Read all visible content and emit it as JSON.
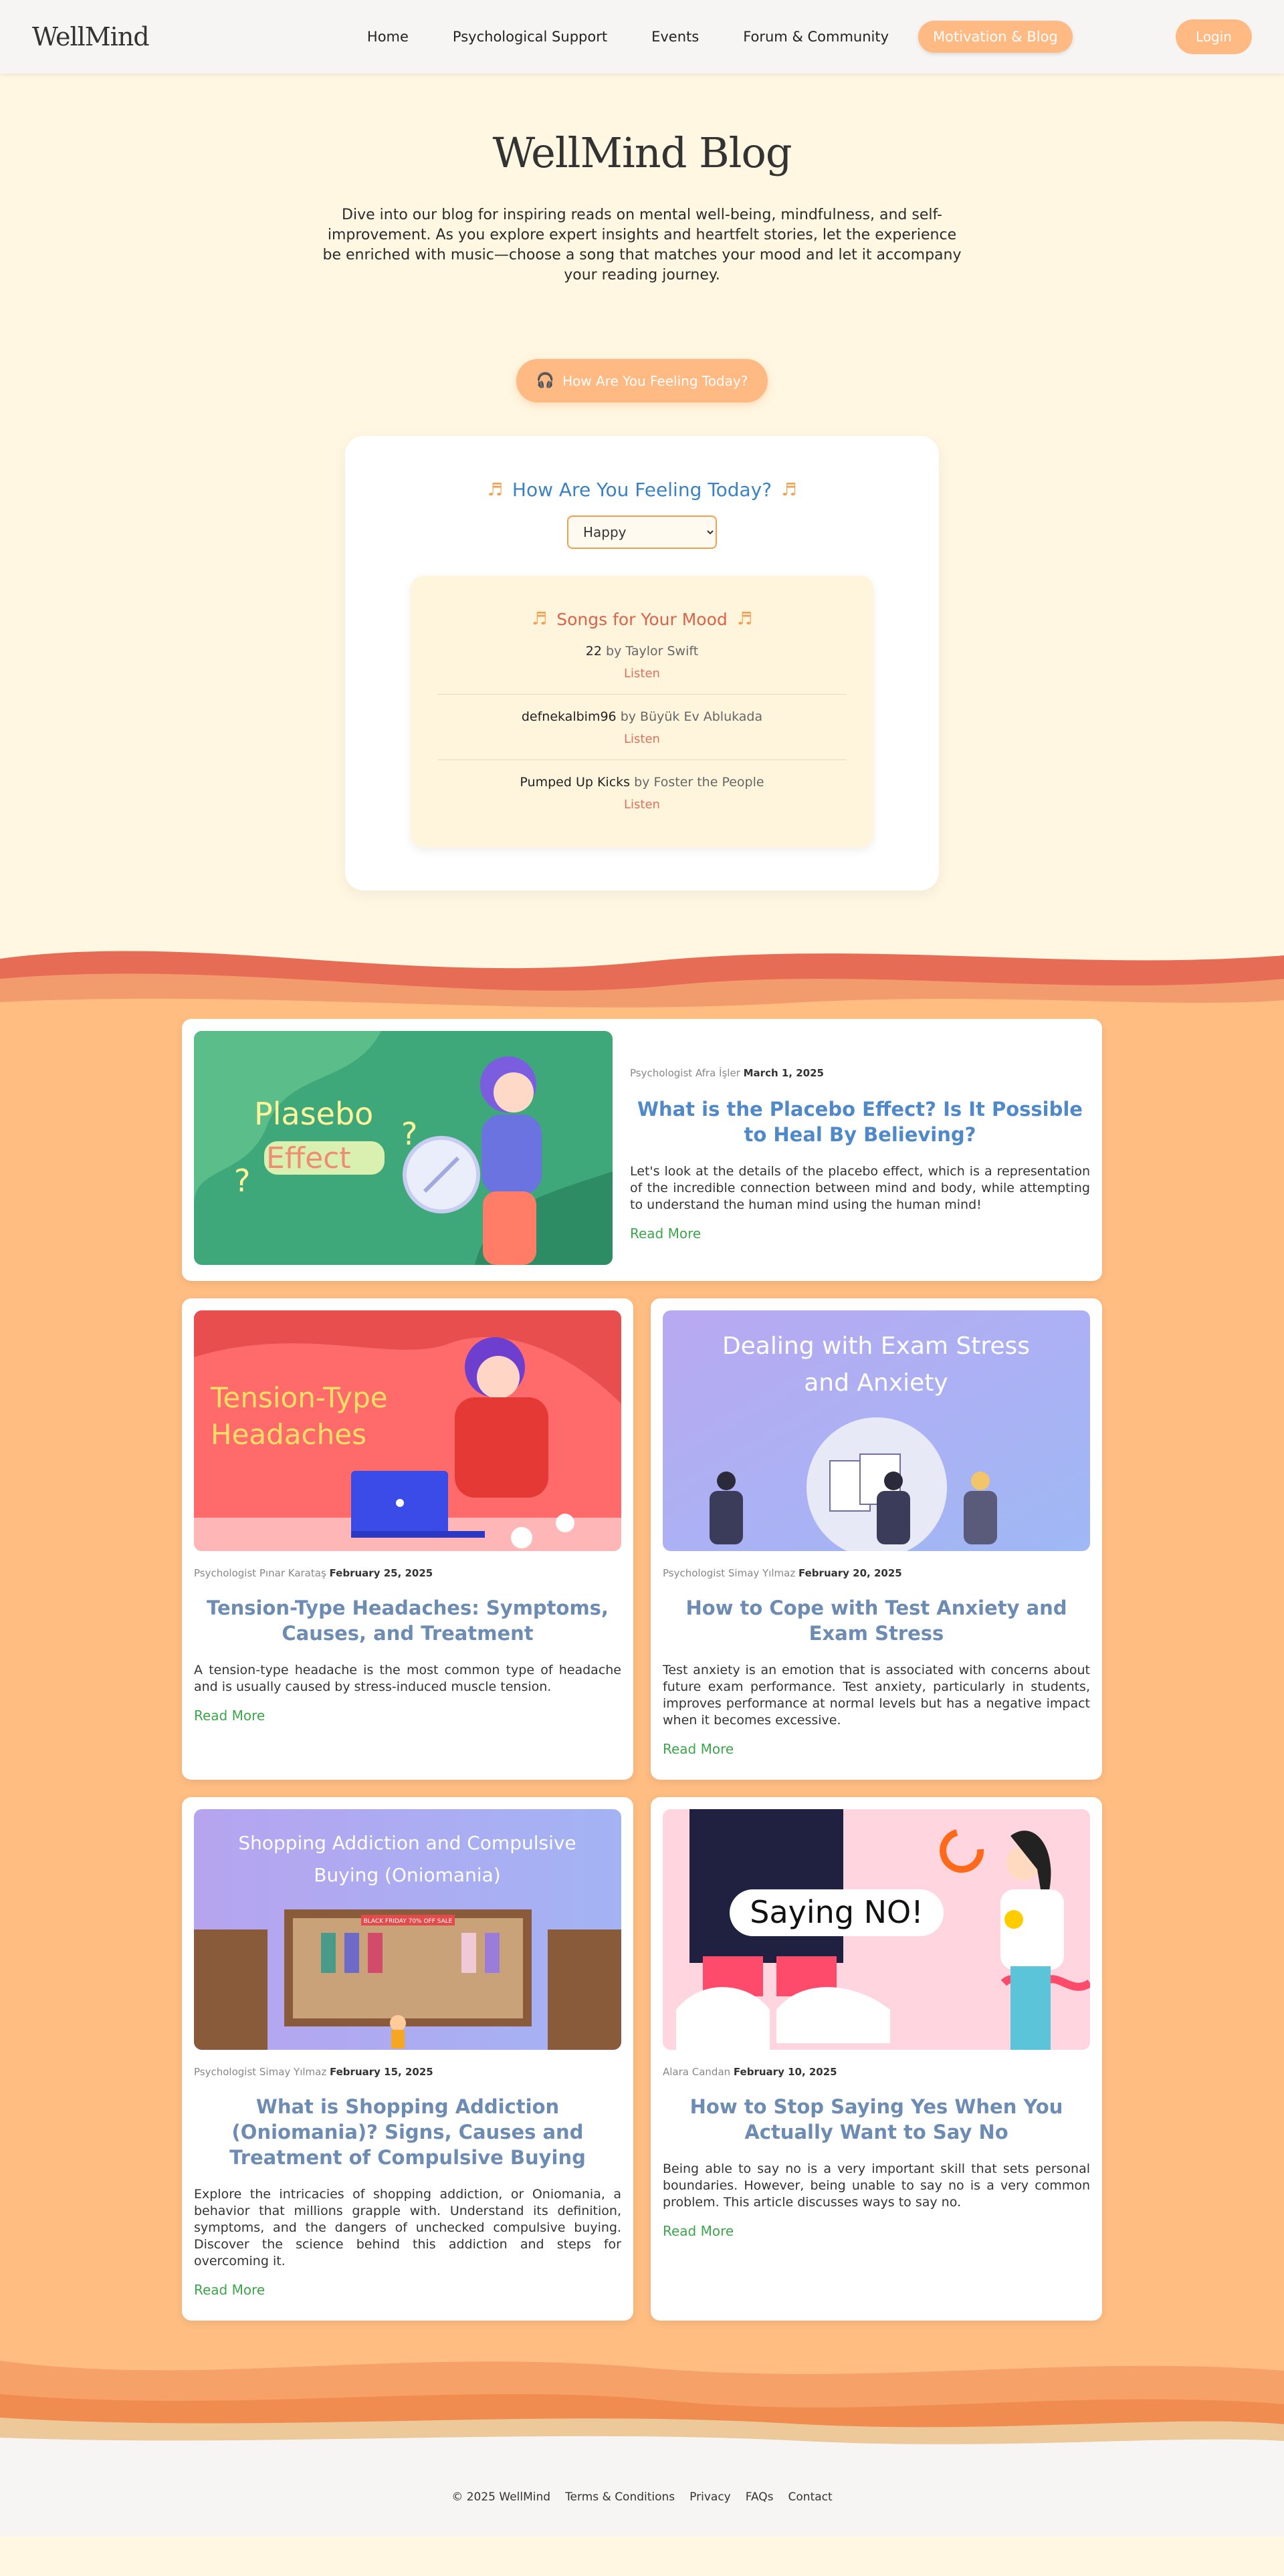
{
  "nav": {
    "logo": "WellMind",
    "links": [
      "Home",
      "Psychological Support",
      "Events",
      "Forum & Community",
      "Motivation & Blog"
    ],
    "login": "Login"
  },
  "hero": {
    "title": "WellMind Blog",
    "intro": "Dive into our blog for inspiring reads on mental well-being, mindfulness, and self-improvement. As you explore expert insights and heartfelt stories, let the experience be enriched with music—choose a song that matches your mood and let it accompany your reading journey.",
    "feeling_button": "How Are You Feeling Today?"
  },
  "mood": {
    "title": "How Are You Feeling Today?",
    "selected": "Happy",
    "songs_title": "Songs for Your Mood",
    "listen_label": "Listen",
    "songs": [
      {
        "title": "22",
        "by": "by",
        "artist": "Taylor Swift"
      },
      {
        "title": "defnekalbim96",
        "by": "by",
        "artist": "Büyük Ev Ablukada"
      },
      {
        "title": "Pumped Up Kicks",
        "by": "by",
        "artist": "Foster the People"
      }
    ]
  },
  "posts": [
    {
      "author": "Psychologist Afra İşler",
      "date": "March 1, 2025",
      "title": "What is the Placebo Effect? Is It Possible to Heal By Believing?",
      "excerpt": "Let's look at the details of the placebo effect, which is a representation of the incredible connection between mind and body, while attempting to understand the human mind using the human mind!",
      "read_more": "Read More",
      "image_text": [
        "Plasebo",
        "Effect"
      ]
    },
    {
      "author": "Psychologist Pınar Karataş",
      "date": "February 25, 2025",
      "title": "Tension-Type Headaches: Symptoms, Causes, and Treatment",
      "excerpt": "A tension-type headache is the most common type of headache and is usually caused by stress-induced muscle tension.",
      "read_more": "Read More",
      "image_text": [
        "Tension-Type",
        "Headaches"
      ]
    },
    {
      "author": "Psychologist Simay Yılmaz",
      "date": "February 20, 2025",
      "title": "How to Cope with Test Anxiety and Exam Stress",
      "excerpt": "Test anxiety is an emotion that is associated with concerns about future exam performance. Test anxiety, particularly in students, improves performance at normal levels but has a negative impact when it becomes excessive.",
      "read_more": "Read More",
      "image_text": [
        "Dealing with Exam Stress",
        "and Anxiety"
      ]
    },
    {
      "author": "Psychologist Simay Yılmaz",
      "date": "February 15, 2025",
      "title": "What is Shopping Addiction (Oniomania)? Signs, Causes and Treatment of Compulsive Buying",
      "excerpt": "Explore the intricacies of shopping addiction, or Oniomania, a behavior that millions grapple with. Understand its definition, symptoms, and the dangers of unchecked compulsive buying. Discover the science behind this addiction and steps for overcoming it.",
      "read_more": "Read More",
      "image_text": [
        "Shopping Addiction and Compulsive",
        "Buying (Oniomania)",
        "BLACK FRIDAY 70% OFF SALE"
      ]
    },
    {
      "author": "Alara Candan",
      "date": "February 10, 2025",
      "title": "How to Stop Saying Yes When You Actually Want to Say No",
      "excerpt": "Being able to say no is a very important skill that sets personal boundaries. However, being unable to say no is a very common problem. This article discusses ways to say no.",
      "read_more": "Read More",
      "image_text": [
        "Saying NO!"
      ]
    }
  ],
  "footer": {
    "copyright": "© 2025 WellMind",
    "links": [
      "Terms & Conditions",
      "Privacy",
      "FAQs",
      "Contact"
    ]
  }
}
